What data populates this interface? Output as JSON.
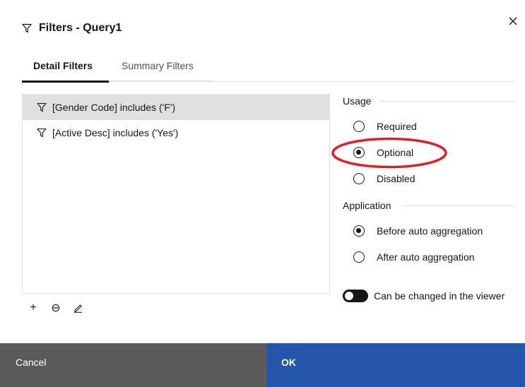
{
  "dialog": {
    "title": "Filters - Query1",
    "close_glyph": "×"
  },
  "tabs": [
    {
      "label": "Detail Filters",
      "active": true
    },
    {
      "label": "Summary Filters",
      "active": false
    }
  ],
  "filters": [
    {
      "text": "[Gender Code] includes ('F')",
      "selected": true,
      "icon": "filter-icon"
    },
    {
      "text": "[Active Desc] includes ('Yes')",
      "selected": false,
      "icon": "filter-icon"
    }
  ],
  "list_toolbar": {
    "add_glyph": "+",
    "remove_glyph": "⊖",
    "edit_icon": "pencil-icon"
  },
  "usage": {
    "label": "Usage",
    "options": [
      "Required",
      "Optional",
      "Disabled"
    ],
    "selected": "Optional"
  },
  "application": {
    "label": "Application",
    "options": [
      "Before auto aggregation",
      "After auto aggregation"
    ],
    "selected": "Before auto aggregation"
  },
  "viewer_toggle": {
    "label": "Can be changed in the viewer",
    "on": false
  },
  "footer": {
    "cancel_label": "Cancel",
    "ok_label": "OK"
  },
  "colors": {
    "cancel_bg": "#5a5a5a",
    "ok_bg": "#2457ab",
    "selected_row_bg": "#e0e0e0",
    "annotation_red": "#e01e26"
  }
}
